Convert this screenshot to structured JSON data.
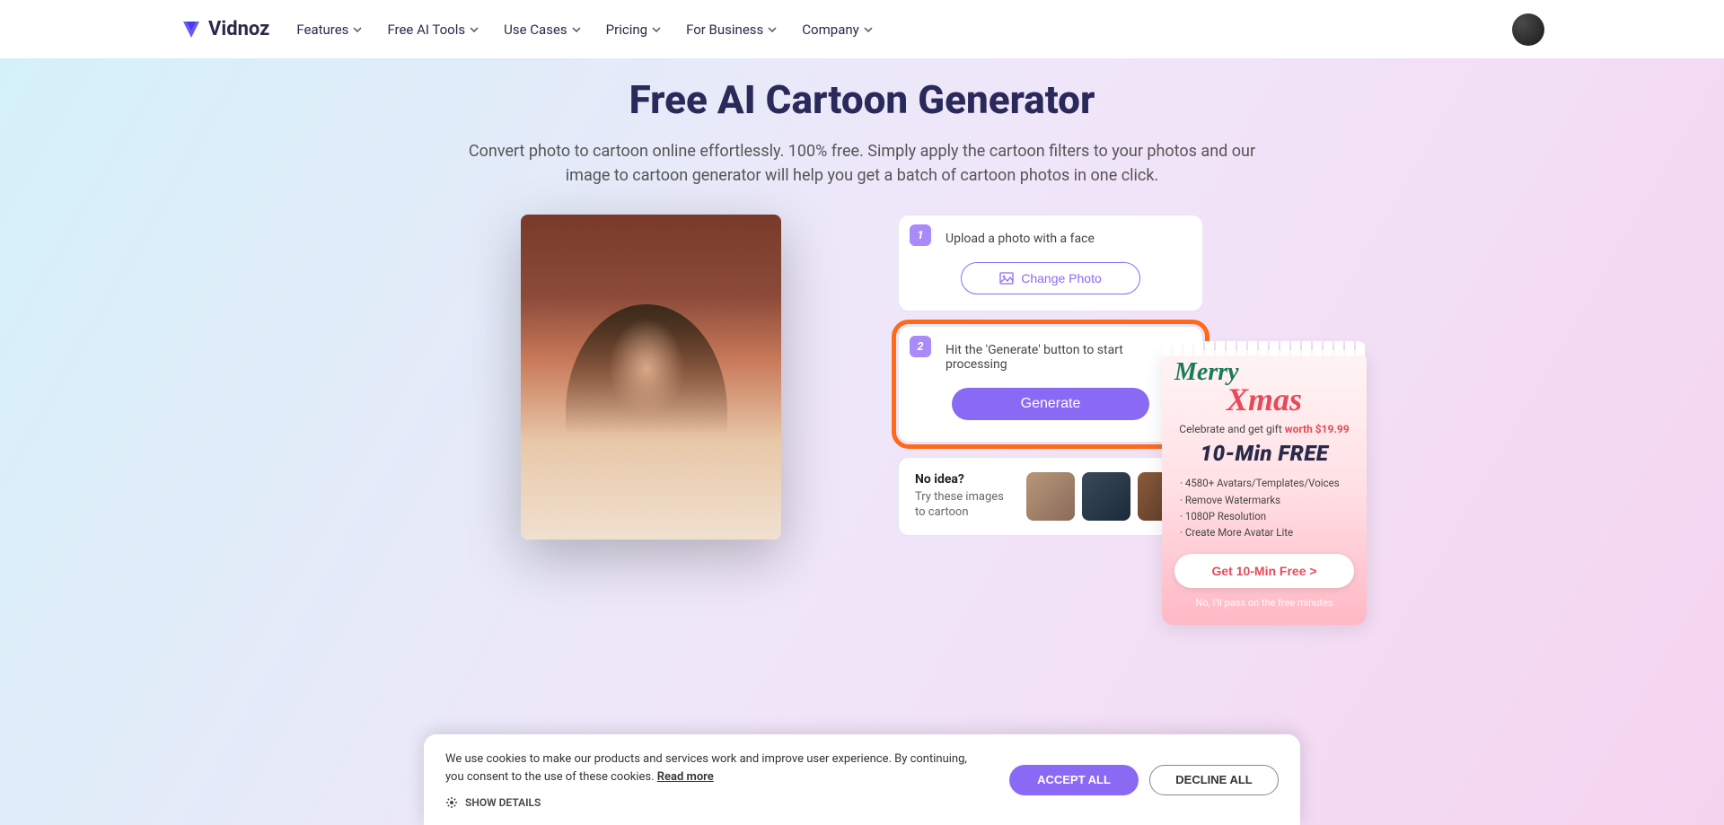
{
  "brand": "Vidnoz",
  "nav": [
    {
      "label": "Features"
    },
    {
      "label": "Free AI Tools"
    },
    {
      "label": "Use Cases"
    },
    {
      "label": "Pricing"
    },
    {
      "label": "For Business"
    },
    {
      "label": "Company"
    }
  ],
  "page": {
    "title": "Free AI Cartoon Generator",
    "subtitle": "Convert photo to cartoon online effortlessly. 100% free. Simply apply the cartoon filters to your photos and our image to cartoon generator will help you get a batch of cartoon photos in one click."
  },
  "steps": {
    "one": {
      "num": "1",
      "text": "Upload a photo with a face",
      "button": "Change Photo"
    },
    "two": {
      "num": "2",
      "text": "Hit the 'Generate' button to start processing",
      "button": "Generate"
    }
  },
  "noidea": {
    "title": "No idea?",
    "sub": "Try these images to cartoon"
  },
  "promo": {
    "merry": "Merry",
    "xmas": "Xmas",
    "celebrate_prefix": "Celebrate and get gift ",
    "worth": "worth $19.99",
    "free": "10-Min FREE",
    "features": [
      "· 4580+ Avatars/Templates/Voices",
      "· Remove Watermarks",
      "· 1080P Resolution",
      "· Create More Avatar Lite"
    ],
    "button": "Get 10-Min Free >",
    "pass": "No, I'll pass on the free minutes"
  },
  "cookies": {
    "text": "We use cookies to make our products and services work and improve user experience. By continuing, you consent to the use of these cookies. ",
    "read_more": "Read more",
    "show_details": "SHOW DETAILS",
    "accept": "ACCEPT ALL",
    "decline": "DECLINE ALL"
  },
  "colors": {
    "accent": "#8a6af5",
    "highlight": "#ff6a1a",
    "promo_red": "#e84a5a"
  }
}
